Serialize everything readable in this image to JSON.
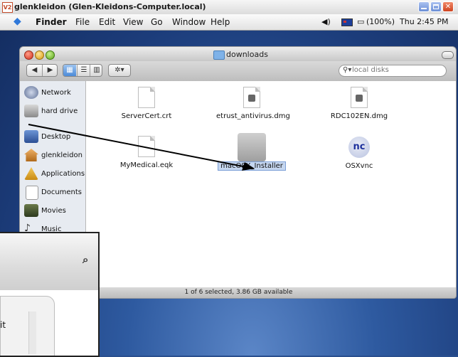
{
  "vnc": {
    "logo": "V2",
    "title": "glenkleidon (Glen-Kleidons-Computer.local)"
  },
  "menubar": {
    "apple": "",
    "items": [
      "Finder",
      "File",
      "Edit",
      "View",
      "Go",
      "Window",
      "Help"
    ],
    "battery": "(100%)",
    "clock": "Thu 2:45 PM"
  },
  "finder": {
    "title": "downloads",
    "search_placeholder": "local disks",
    "sidebar": [
      {
        "label": "Network",
        "icon": "network-icon"
      },
      {
        "label": "hard drive",
        "icon": "hard-drive-icon"
      },
      {
        "label": "Desktop",
        "icon": "desktop-icon"
      },
      {
        "label": "glenkleidon",
        "icon": "home-icon"
      },
      {
        "label": "Applications",
        "icon": "applications-icon"
      },
      {
        "label": "Documents",
        "icon": "documents-icon"
      },
      {
        "label": "Movies",
        "icon": "movies-icon"
      },
      {
        "label": "Music",
        "icon": "music-icon"
      }
    ],
    "files": [
      {
        "name": "ServerCert.crt",
        "icon": "document-icon"
      },
      {
        "name": "etrust_antivirus.dmg",
        "icon": "disk-image-icon"
      },
      {
        "name": "RDC102EN.dmg",
        "icon": "disk-image-icon"
      },
      {
        "name": "MyMedical.eqk",
        "icon": "document-icon"
      },
      {
        "name": "macOSX_Installer",
        "icon": "installer-icon",
        "selected": true
      },
      {
        "name": "OSXvnc",
        "icon": "vnc-app-icon"
      }
    ],
    "status": "1 of 6 selected, 3.86 GB available"
  },
  "overlay": {
    "text": "it"
  }
}
